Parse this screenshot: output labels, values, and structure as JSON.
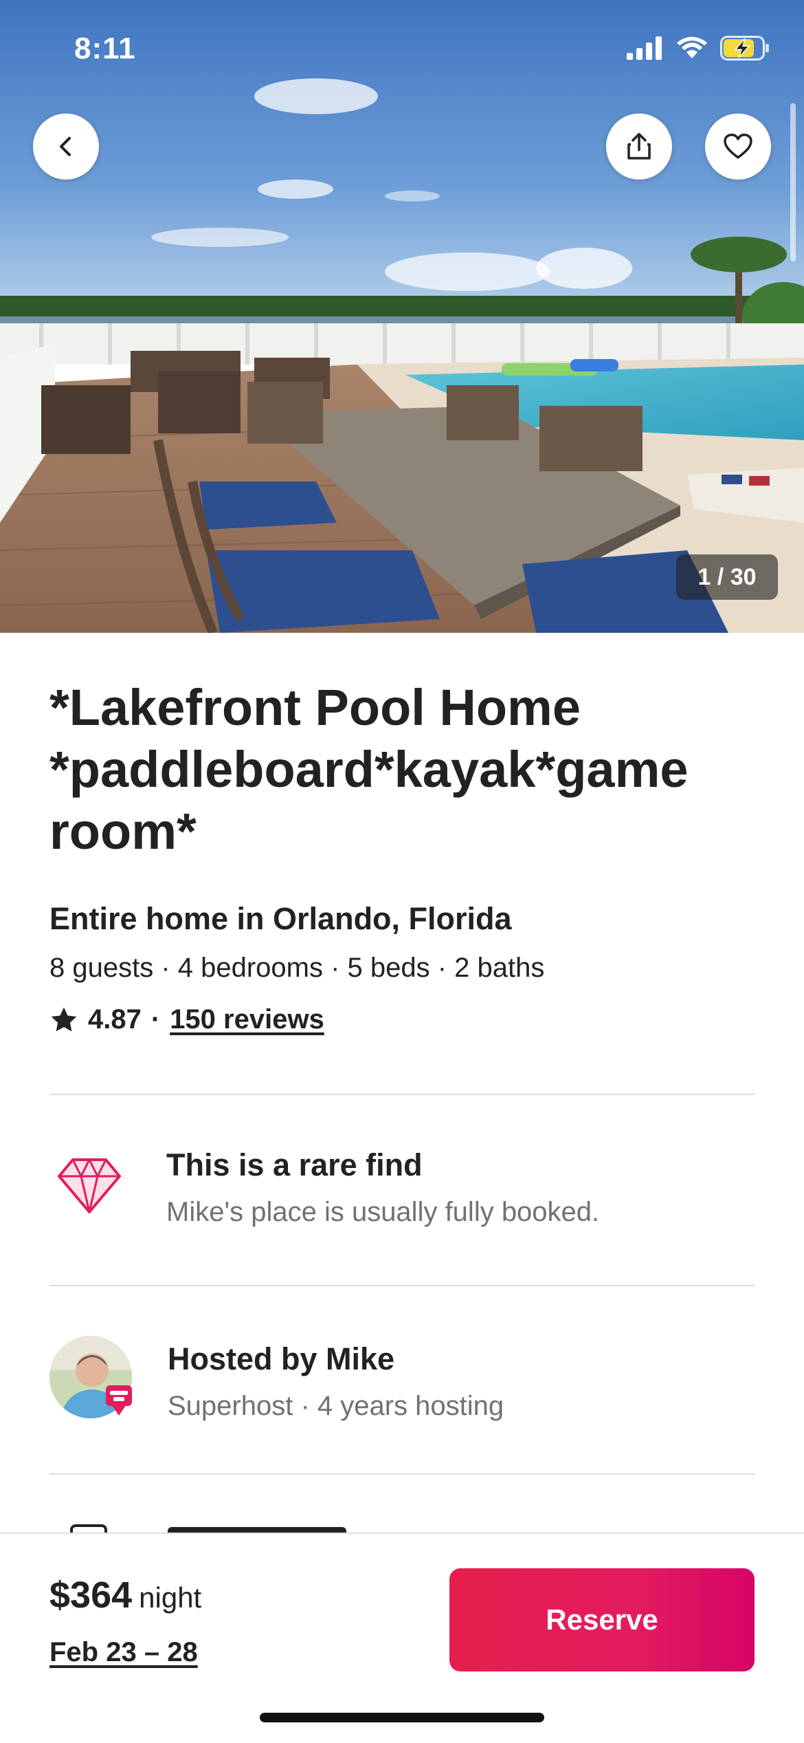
{
  "status_bar": {
    "time": "8:11",
    "icons": [
      "cellular-signal-icon",
      "wifi-icon",
      "battery-charging-icon"
    ]
  },
  "hero": {
    "photo_counter": "1 / 30",
    "buttons": [
      "back-icon",
      "share-icon",
      "heart-icon"
    ]
  },
  "listing": {
    "title": "*Lakefront Pool Home *paddleboard*kayak*game room*",
    "subtitle": "Entire home in Orlando, Florida",
    "details": "8 guests · 4 bedrooms · 5 beds · 2 baths",
    "rating": "4.87",
    "separator": "·",
    "reviews": "150 reviews"
  },
  "highlights": {
    "rare_find": {
      "title": "This is a rare find",
      "subtitle": "Mike's place is usually fully booked.",
      "icon": "diamond-icon"
    },
    "host": {
      "title": "Hosted by Mike",
      "subtitle": "Superhost · 4 years hosting",
      "icon": "superhost-badge-icon"
    }
  },
  "footer": {
    "price": "$364",
    "price_unit": "night",
    "dates": "Feb 23 – 28",
    "reserve_label": "Reserve"
  },
  "colors": {
    "brand": "#e61e4d",
    "text_primary": "#222222",
    "text_secondary": "#717171",
    "divider": "#dddddd"
  }
}
